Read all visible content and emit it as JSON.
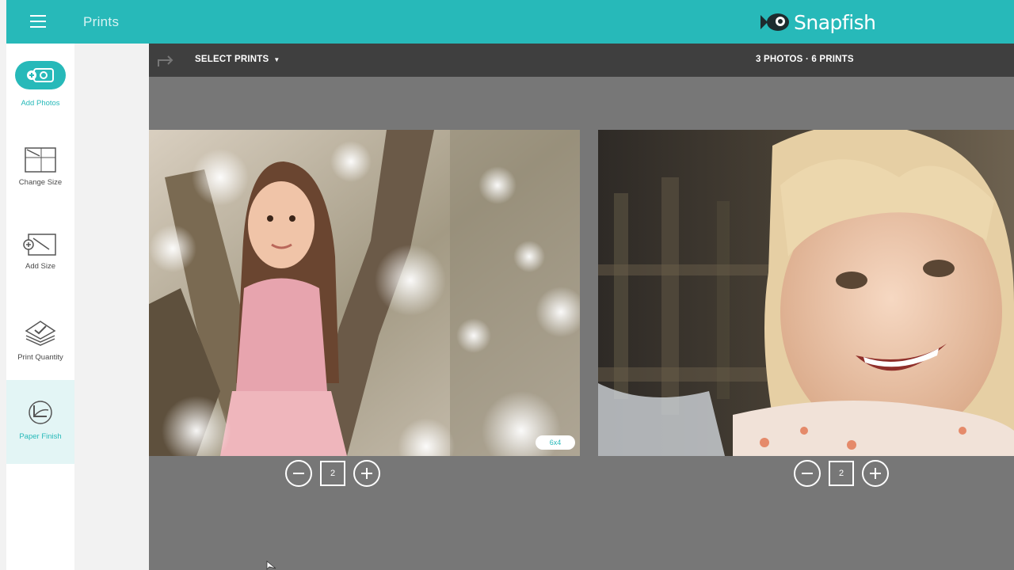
{
  "header": {
    "title": "Prints",
    "brand": "Snapfish",
    "menu_icon": "hamburger-icon",
    "brand_color": "#27b9b9"
  },
  "sidebar": {
    "items": [
      {
        "label": "Add Photos",
        "icon": "add-photos-icon"
      },
      {
        "label": "Change Size",
        "icon": "change-size-icon"
      },
      {
        "label": "Add Size",
        "icon": "add-size-icon"
      },
      {
        "label": "Print Quantity",
        "icon": "print-quantity-icon"
      },
      {
        "label": "Paper Finish",
        "icon": "paper-finish-icon",
        "active": true
      }
    ]
  },
  "toolbar": {
    "select_label": "SELECT PRINTS",
    "counts": "3 PHOTOS · 6 PRINTS",
    "redo_icon": "redo-icon"
  },
  "photos": [
    {
      "size": "6x4",
      "quantity": "2"
    },
    {
      "quantity": "2"
    }
  ]
}
